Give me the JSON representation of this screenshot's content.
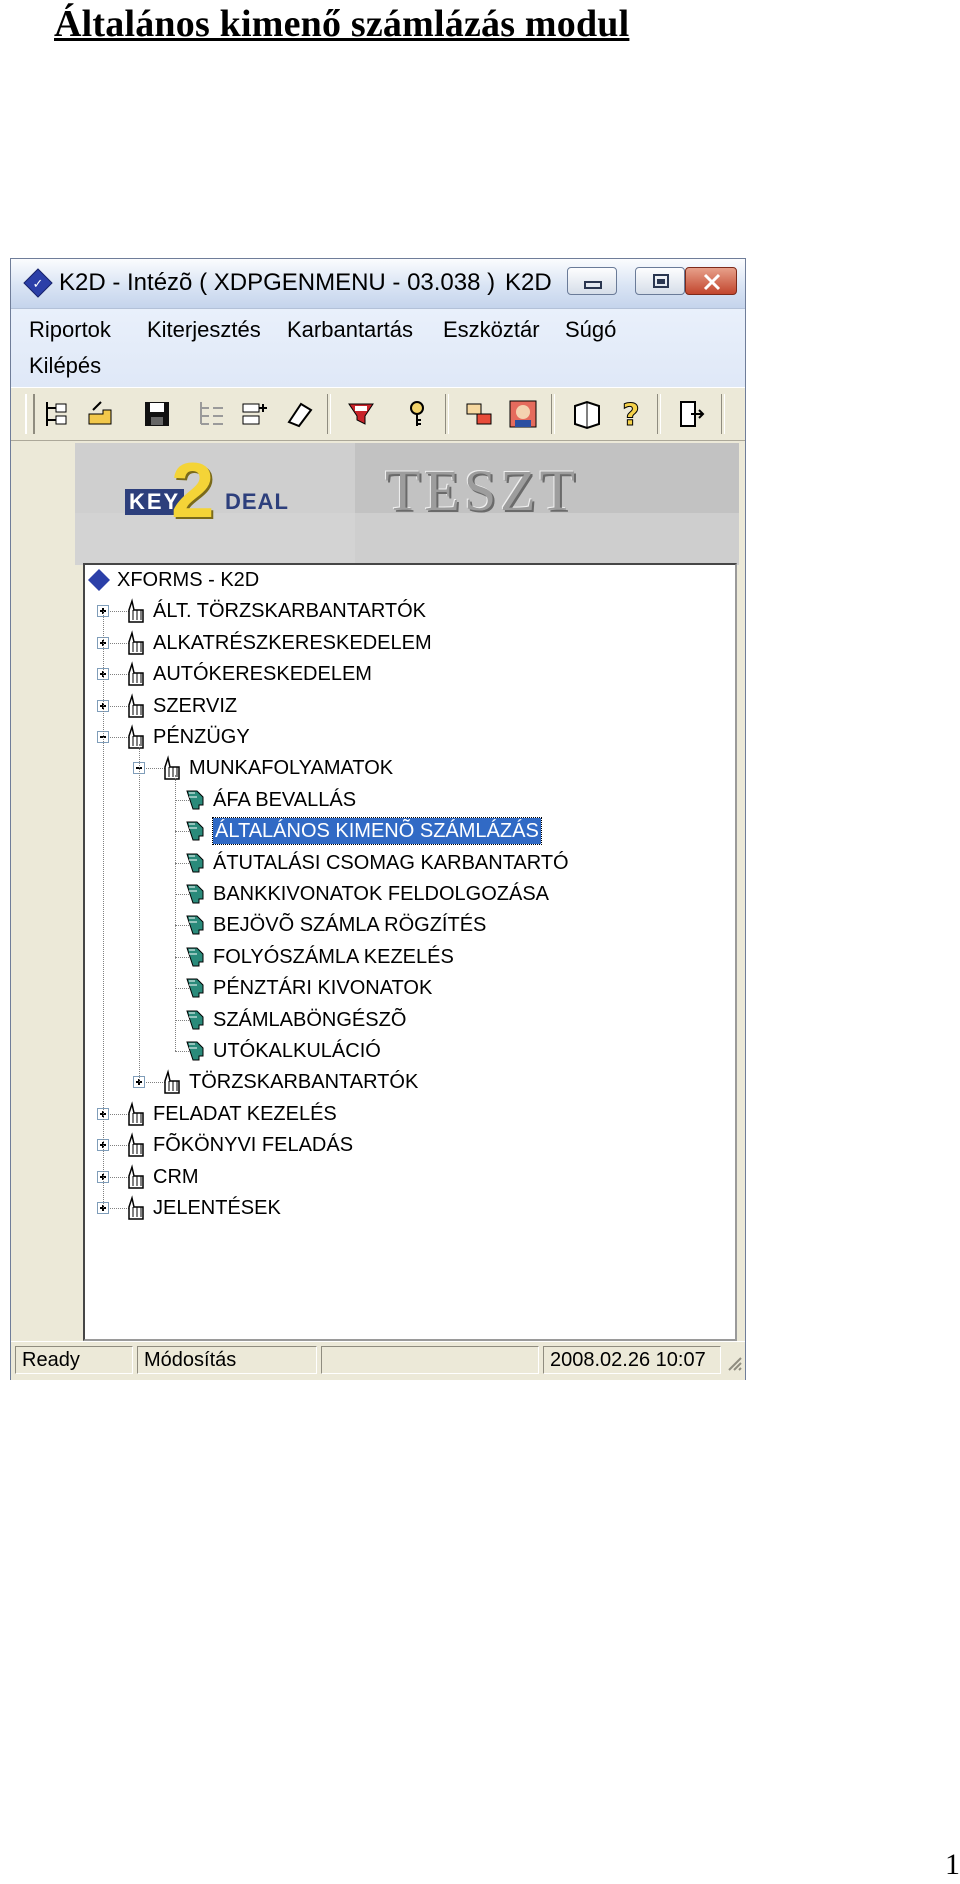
{
  "document": {
    "title": "Általános kimenő számlázás modul",
    "page_number": "1"
  },
  "window": {
    "title": "K2D - Intézõ ( XDPGENMENU - 03.038 )",
    "title_right": "K2D",
    "icons": {
      "app": "app-diamond-icon",
      "minimize": "minimize-icon",
      "maximize": "maximize-icon",
      "close": "close-icon"
    }
  },
  "menu": {
    "items": [
      "Riportok",
      "Kiterjesztés",
      "Karbantartás",
      "Eszköztár",
      "Súgó",
      "Kilépés"
    ]
  },
  "toolbar": {
    "icons": [
      "tree-view-icon",
      "hand-pointer-icon",
      "save-icon",
      "list-disabled-icon",
      "list-add-icon",
      "eraser-icon",
      "filter-icon",
      "key-icon",
      "transfer-icon",
      "user-portrait-icon",
      "book-icon",
      "help-icon",
      "exit-door-icon"
    ]
  },
  "banner": {
    "logo_left": "KEY",
    "logo_digit": "2",
    "logo_right": "DEAL",
    "label": "TESZT"
  },
  "tree": {
    "root": "XFORMS - K2D",
    "items": [
      {
        "label": "ÁLT. TÖRZSKARBANTARTÓK",
        "level": 1,
        "expander": "plus"
      },
      {
        "label": "ALKATRÉSZKERESKEDELEM",
        "level": 1,
        "expander": "plus"
      },
      {
        "label": "AUTÓKERESKEDELEM",
        "level": 1,
        "expander": "plus"
      },
      {
        "label": "SZERVIZ",
        "level": 1,
        "expander": "plus"
      },
      {
        "label": "PÉNZÜGY",
        "level": 1,
        "expander": "minus"
      },
      {
        "label": "MUNKAFOLYAMATOK",
        "level": 2,
        "expander": "minus"
      },
      {
        "label": "ÁFA BEVALLÁS",
        "level": 3
      },
      {
        "label": "ÁLTALÁNOS KIMENÕ SZÁMLÁZÁS",
        "level": 3,
        "selected": true
      },
      {
        "label": "ÁTUTALÁSI CSOMAG KARBANTARTÓ",
        "level": 3
      },
      {
        "label": "BANKKIVONATOK FELDOLGOZÁSA",
        "level": 3
      },
      {
        "label": "BEJÖVÕ SZÁMLA RÖGZÍTÉS",
        "level": 3
      },
      {
        "label": "FOLYÓSZÁMLA KEZELÉS",
        "level": 3
      },
      {
        "label": "PÉNZTÁRI KIVONATOK",
        "level": 3
      },
      {
        "label": "SZÁMLABÖNGÉSZÕ",
        "level": 3
      },
      {
        "label": "UTÓKALKULÁCIÓ",
        "level": 3
      },
      {
        "label": "TÖRZSKARBANTARTÓK",
        "level": 2,
        "expander": "plus"
      },
      {
        "label": "FELADAT KEZELÉS",
        "level": 1,
        "expander": "plus"
      },
      {
        "label": "FÕKÖNYVI FELADÁS",
        "level": 1,
        "expander": "plus"
      },
      {
        "label": "CRM",
        "level": 1,
        "expander": "plus"
      },
      {
        "label": "JELENTÉSEK",
        "level": 1,
        "expander": "plus"
      }
    ]
  },
  "status": {
    "state": "Ready",
    "mode": "Módosítás",
    "extra": "",
    "datetime": "2008.02.26 10:07"
  },
  "colors": {
    "selection": "#316ac5",
    "window_face": "#ece9d8",
    "titlebar": "#d9e4f4"
  }
}
